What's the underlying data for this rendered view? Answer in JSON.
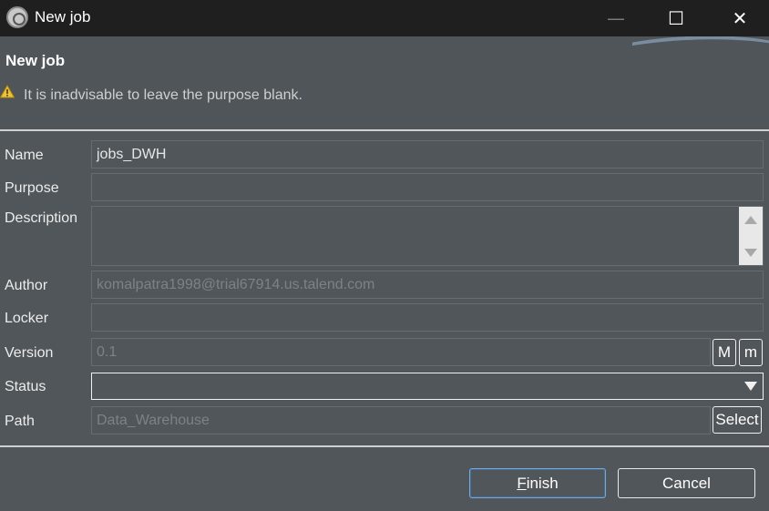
{
  "window": {
    "title": "New job",
    "minimize_glyph": "—",
    "maximize_glyph": "☐",
    "close_glyph": "✕"
  },
  "header": {
    "page_title": "New job",
    "warning": "It is inadvisable to leave the purpose blank."
  },
  "form": {
    "name_label": "Name",
    "name_value": "jobs_DWH",
    "purpose_label": "Purpose",
    "purpose_value": "",
    "description_label": "Description",
    "description_value": "",
    "author_label": "Author",
    "author_value": "komalpatra1998@trial67914.us.talend.com",
    "locker_label": "Locker",
    "locker_value": "",
    "version_label": "Version",
    "version_value": "0.1",
    "version_major_label": "M",
    "version_minor_label": "m",
    "status_label": "Status",
    "status_value": "",
    "path_label": "Path",
    "path_value": "Data_Warehouse",
    "select_label": "Select"
  },
  "footer": {
    "finish_mnemonic": "F",
    "finish_rest": "inish",
    "cancel_label": "Cancel"
  },
  "icons": {
    "app": "talend-studio-icon",
    "warning": "warning-icon"
  },
  "colors": {
    "background": "#50565a",
    "titlebar": "#1f1f1f",
    "primary_button_border": "#7fa6cf",
    "warning": "#f2c230"
  }
}
